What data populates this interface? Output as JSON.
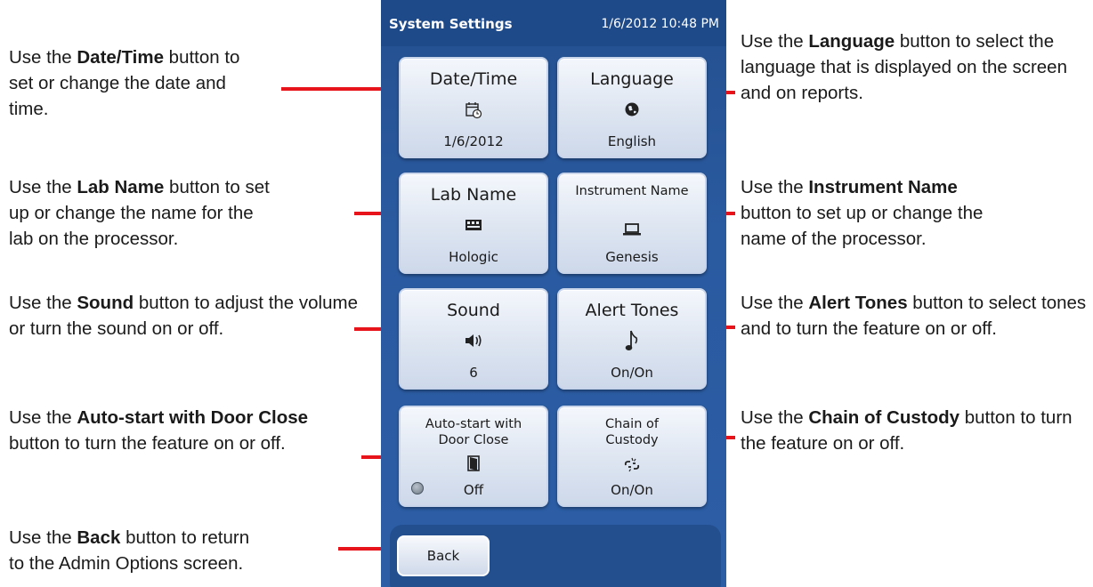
{
  "screen": {
    "title": "System Settings",
    "datetime": "1/6/2012 10:48 PM",
    "back_label": "Back"
  },
  "tiles": [
    {
      "label": "Date/Time",
      "icon": "calendar-clock-icon",
      "glyph": "📅",
      "value": "1/6/2012"
    },
    {
      "label": "Language",
      "icon": "globe-icon",
      "glyph": "🌍",
      "value": "English"
    },
    {
      "label": "Lab Name",
      "icon": "lab-building-icon",
      "glyph": "🖫",
      "value": "Hologic"
    },
    {
      "label": "Instrument Name",
      "icon": "laptop-icon",
      "glyph": "💻",
      "value": "Genesis"
    },
    {
      "label": "Sound",
      "icon": "speaker-icon",
      "glyph": "🔊",
      "value": "6"
    },
    {
      "label": "Alert Tones",
      "icon": "music-note-icon",
      "glyph": "♪",
      "value": "On/On"
    },
    {
      "label": "Auto-start with Door Close",
      "icon": "door-icon",
      "glyph": "🚪",
      "value": "Off"
    },
    {
      "label": "Chain of Custody",
      "icon": "broken-chain-icon",
      "glyph": "⛓",
      "value": "On/On"
    }
  ],
  "notes": {
    "datetime": {
      "pre": "Use the ",
      "bold": "Date/Time",
      "post": " button to set or change the date and time."
    },
    "labname": {
      "pre": "Use the ",
      "bold": "Lab Name",
      "post": " button to set up or change the name for the lab on the processor."
    },
    "sound": {
      "pre": "Use the ",
      "bold": "Sound",
      "post": " button to adjust the volume or turn the sound on or off."
    },
    "autostart": {
      "pre": "Use the ",
      "bold": "Auto-start with Door Close",
      "post": " button to turn the feature on or off."
    },
    "back": {
      "pre": "Use the ",
      "bold": "Back",
      "post": " button to return to the Admin Options screen."
    },
    "language": {
      "pre": "Use the ",
      "bold": "Language",
      "post": " button to select the language that is displayed on the screen and on reports."
    },
    "instrument": {
      "pre": "Use the ",
      "bold": "Instrument Name",
      "post": " button to set up or change the name of the processor."
    },
    "alerttones": {
      "pre": "Use the ",
      "bold": "Alert Tones",
      "post": " button to select tones and to turn the feature on or off."
    },
    "custody": {
      "pre": "Use the ",
      "bold": "Chain of Custody",
      "post": " button to turn the feature on or off."
    }
  },
  "colors": {
    "leader_red": "#e8141b",
    "screen_blue": "#2a5aa0",
    "tile_light": "#dde5f1"
  }
}
